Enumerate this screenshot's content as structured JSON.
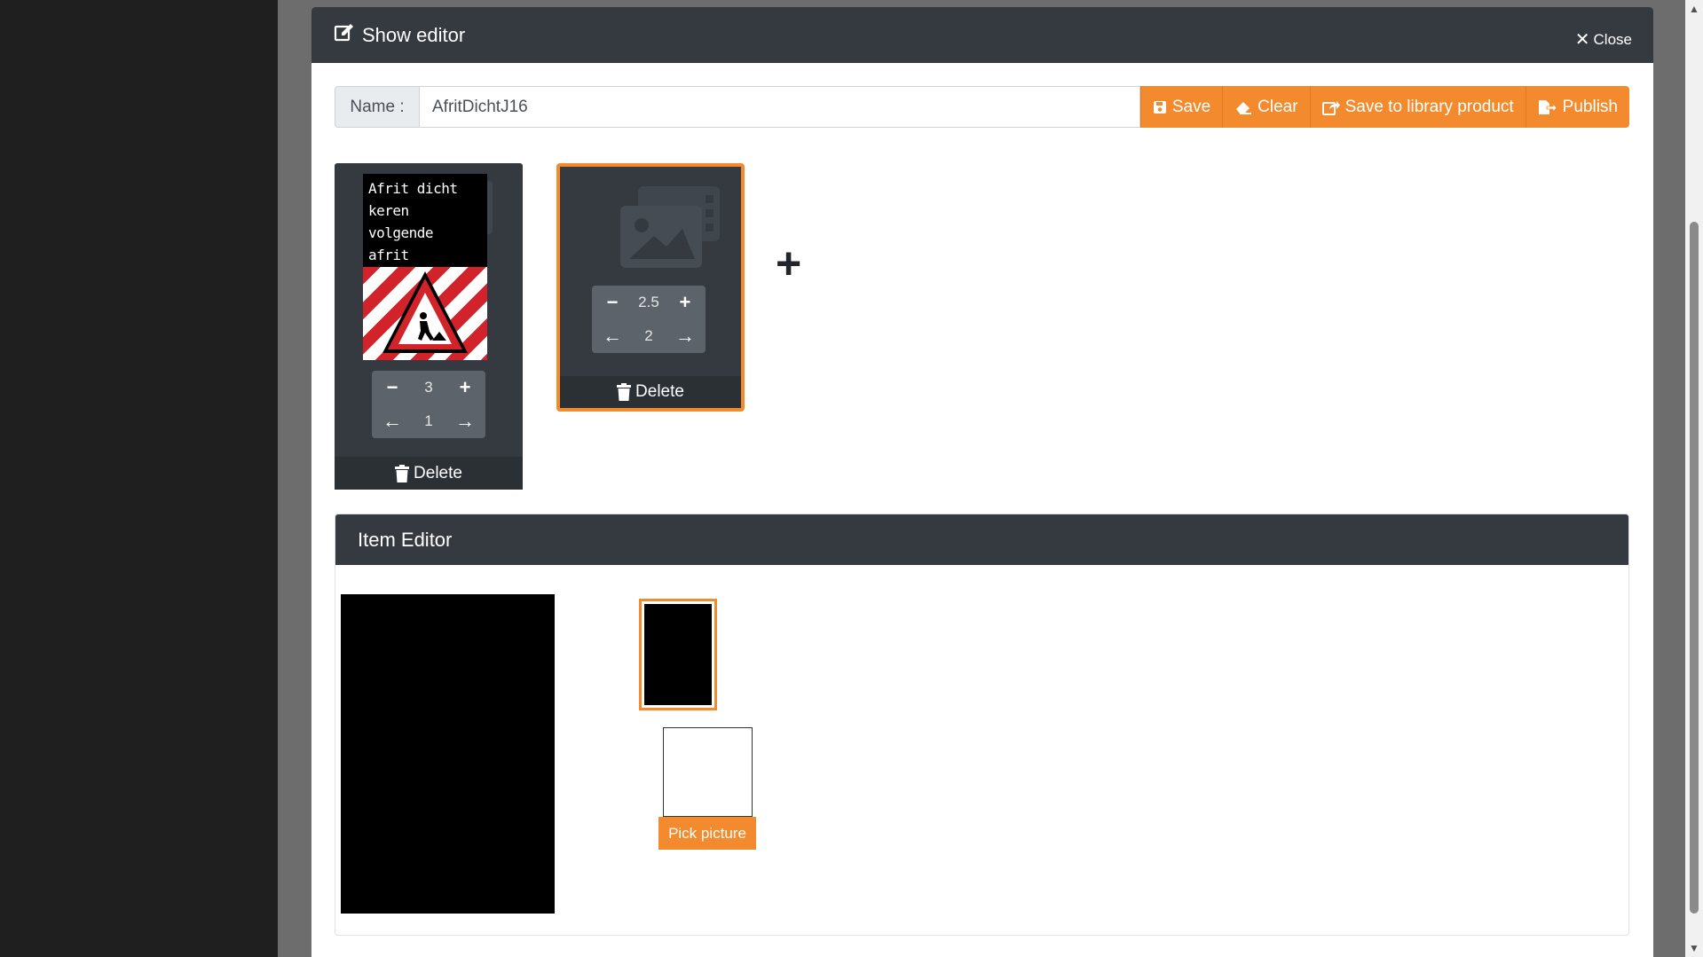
{
  "modal": {
    "title": "Show editor",
    "close_label": "Close"
  },
  "name_row": {
    "label": "Name :",
    "value": "AfritDichtJ16"
  },
  "toolbar": {
    "save_label": "Save",
    "clear_label": "Clear",
    "save_library_label": "Save to library product",
    "publish_label": "Publish"
  },
  "slides": [
    {
      "sign_lines": [
        "Afrit dicht",
        "keren",
        "volgende",
        "afrit"
      ],
      "duration": "3",
      "position": "1",
      "delete_label": "Delete"
    },
    {
      "duration": "2.5",
      "position": "2",
      "delete_label": "Delete"
    }
  ],
  "item_editor": {
    "title": "Item Editor",
    "pick_label": "Pick picture"
  },
  "colors": {
    "accent": "#f38a2e",
    "header": "#343a40"
  }
}
